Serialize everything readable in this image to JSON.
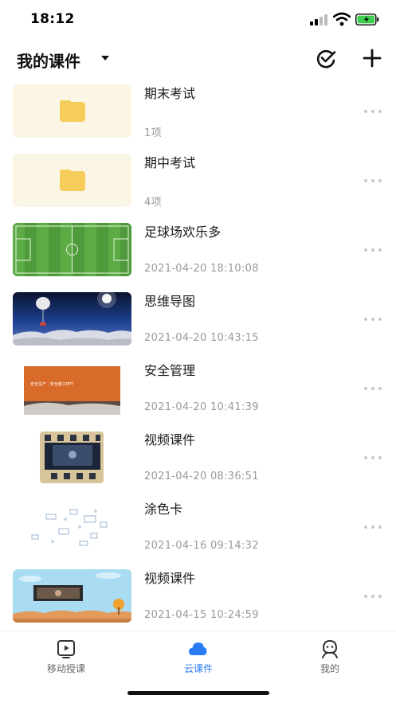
{
  "status_bar": {
    "time": "18:12"
  },
  "header": {
    "title": "我的课件"
  },
  "items": [
    {
      "title": "期末考试",
      "meta": "1项",
      "thumb": "folder"
    },
    {
      "title": "期中考试",
      "meta": "4项",
      "thumb": "folder"
    },
    {
      "title": "足球场欢乐多",
      "meta": "2021-04-20 18:10:08",
      "thumb": "soccer"
    },
    {
      "title": "思维导图",
      "meta": "2021-04-20 10:43:15",
      "thumb": "space"
    },
    {
      "title": "安全管理",
      "meta": "2021-04-20 10:41:39",
      "thumb": "safety",
      "thumb_caption": "安全生产 · 安全施工PPT"
    },
    {
      "title": "视频课件",
      "meta": "2021-04-20 08:36:51",
      "thumb": "chessboard"
    },
    {
      "title": "涂色卡",
      "meta": "2021-04-16 09:14:32",
      "thumb": "coloring"
    },
    {
      "title": "视频课件",
      "meta": "2021-04-15 10:24:59",
      "thumb": "sky"
    }
  ],
  "tabs": [
    {
      "label": "移动授课",
      "icon": "play-screen-icon",
      "active": false
    },
    {
      "label": "云课件",
      "icon": "cloud-icon",
      "active": true
    },
    {
      "label": "我的",
      "icon": "profile-icon",
      "active": false
    }
  ],
  "colors": {
    "accent": "#2a7cf6",
    "folder": "#f6cd5a",
    "folder_bg": "#fbf5e6",
    "meta": "#9a9a9a"
  }
}
